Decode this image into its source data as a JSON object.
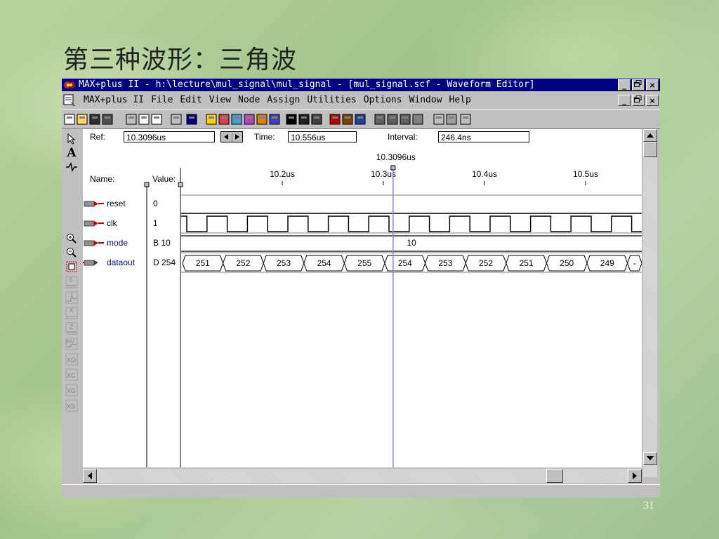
{
  "slide": {
    "title": "第三种波形：三角波",
    "page_number": "31"
  },
  "window": {
    "title": "MAX+plus II - h:\\lecture\\mul_signal\\mul_signal - [mul_signal.scf - Waveform Editor]",
    "caption_min": "_",
    "caption_max": "□",
    "caption_close": "×"
  },
  "menu": {
    "app_label": "MAX+plus II",
    "items": [
      "File",
      "Edit",
      "View",
      "Node",
      "Assign",
      "Utilities",
      "Options",
      "Window",
      "Help"
    ]
  },
  "toolbar_icons": [
    "new-icon",
    "open-icon",
    "save-icon",
    "print-icon",
    "cut-icon",
    "copy-icon",
    "paste-icon",
    "undo-icon",
    "help-pointer-icon",
    "compile-icon",
    "simulate-icon",
    "timing-icon",
    "waveform-icon",
    "programmer-icon",
    "edit-icon",
    "hierarchy-icon",
    "project-icon",
    "floorplan-icon",
    "save-check-icon",
    "save-compile-icon",
    "save-simulate-icon",
    "find-node-icon",
    "find-next-icon",
    "back-annotate-icon",
    "assign-icon",
    "grid-icon",
    "grid2-icon",
    "zoom-window-icon"
  ],
  "editor": {
    "ref_label": "Ref:",
    "ref_value": "10.3096us",
    "time_label": "Time:",
    "time_value": "10.556us",
    "interval_label": "Interval:",
    "interval_value": "246.4ns",
    "cursor_label": "10.3096us",
    "name_header": "Name:",
    "value_header": "Value:",
    "time_ticks": [
      {
        "label": "10.2us",
        "t": 10.2
      },
      {
        "label": "10.3us",
        "t": 10.3
      },
      {
        "label": "10.4us",
        "t": 10.4
      },
      {
        "label": "10.5us",
        "t": 10.5
      }
    ],
    "ref_time": 10.3096,
    "signals": [
      {
        "name": "reset",
        "value": "0",
        "kind": "input"
      },
      {
        "name": "clk",
        "value": "1",
        "kind": "input"
      },
      {
        "name": "mode",
        "value": "B 10",
        "kind": "input-bus",
        "bus_label": "10"
      },
      {
        "name": "dataout",
        "value": "D 254",
        "kind": "output-bus",
        "bus_values": [
          "251",
          "252",
          "253",
          "254",
          "255",
          "254",
          "253",
          "252",
          "251",
          "250",
          "249",
          "-"
        ]
      }
    ]
  },
  "colors": {
    "window_title": "#000080",
    "cursor": "#8080ff",
    "signal_name_mode": "#000080",
    "signal_name_dataout": "#000080"
  }
}
